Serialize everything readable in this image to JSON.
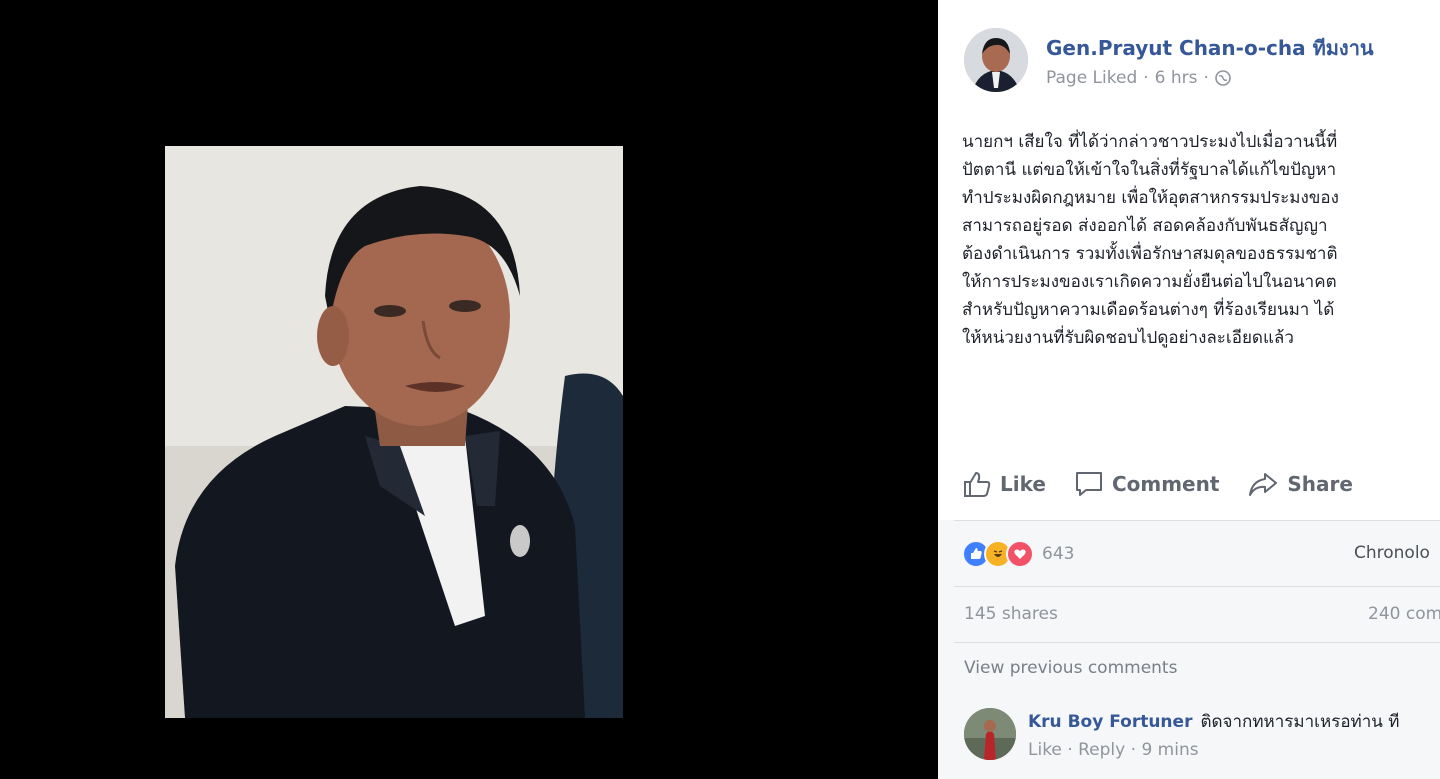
{
  "post": {
    "page_name": "Gen.Prayut Chan-o-cha ทีมงาน",
    "meta_status": "Page Liked",
    "meta_sep": "·",
    "meta_time": "6 hrs",
    "meta_sep2": "·",
    "lines": [
      "นายกฯ เสียใจ ที่ได้ว่ากล่าวชาวประมงไปเมื่อวานนี้ที่",
      "ปัตตานี แต่ขอให้เข้าใจในสิ่งที่รัฐบาลได้แก้ไขปัญหา",
      "ทำประมงผิดกฎหมาย เพื่อให้อุตสาหกรรมประมงของ",
      "สามารถอยู่รอด ส่งออกได้ สอดคล้องกับพันธสัญญา",
      "ต้องดำเนินการ รวมทั้งเพื่อรักษาสมดุลของธรรมชาติ",
      "ให้การประมงของเราเกิดความยั่งยืนต่อไปในอนาคต",
      "สำหรับปัญหาความเดือดร้อนต่างๆ ที่ร้องเรียนมา ได้",
      "ให้หน่วยงานที่รับผิดชอบไปดูอย่างละเอียดแล้ว"
    ]
  },
  "actions": {
    "like": "Like",
    "comment": "Comment",
    "share": "Share"
  },
  "stats": {
    "reaction_count": "643",
    "sort_label": "Chronolo",
    "shares": "145 shares",
    "comments": "240 com"
  },
  "comments": {
    "view_previous": "View previous comments",
    "items": [
      {
        "author": "Kru Boy Fortuner",
        "text": "ติดจากทหารมาเหรอท่าน ที",
        "like": "Like",
        "reply": "Reply",
        "sep": "·",
        "time": "9 mins"
      }
    ]
  },
  "colors": {
    "link_blue": "#365899",
    "meta_gray": "#90949c",
    "like_blue": "#4080ff",
    "haha_yellow": "#f7b125",
    "love_red": "#f25268"
  },
  "icons": [
    "globe-icon",
    "thumbs-up-icon",
    "comment-bubble-icon",
    "share-arrow-icon",
    "like-reaction-icon",
    "haha-reaction-icon",
    "love-reaction-icon"
  ]
}
